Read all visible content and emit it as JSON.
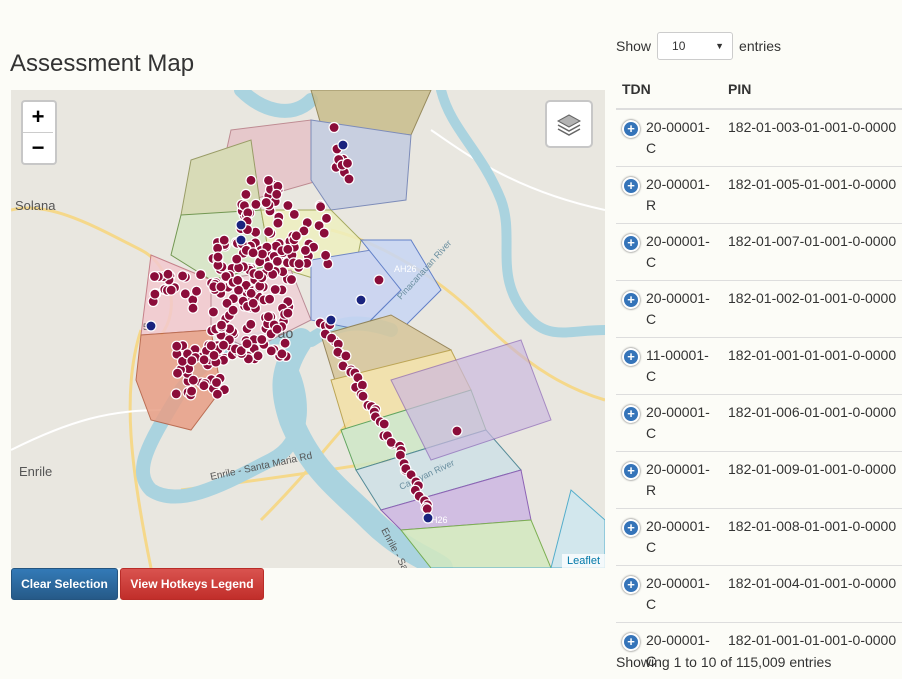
{
  "page": {
    "title": "Assessment Map"
  },
  "map": {
    "zoom_in": "+",
    "zoom_out": "−",
    "layers_icon": "layers-icon",
    "attribution": "Leaflet",
    "place_labels": {
      "solana": "Solana",
      "enrile": "Enrile",
      "rao": "rao",
      "road_ah26_a": "AH26",
      "road_ah26_b": "AH26",
      "road_enrile_santa_maria": "Enrile - Santa Maria Rd",
      "road_enrile_san": "Enrile - San",
      "river_pinacanauan": "Pinacanauan River",
      "river_cagayan": "Cagayan River",
      "road_51": "51"
    },
    "colors": {
      "marker_fill": "#8b0d3a",
      "marker_blue": "#1a237e",
      "river": "#aad3df"
    }
  },
  "buttons": {
    "clear_selection": "Clear Selection",
    "hotkeys_legend": "View Hotkeys Legend"
  },
  "table_controls": {
    "show_label": "Show",
    "length_value": "10",
    "entries_label": "entries"
  },
  "table": {
    "columns": [
      "TDN",
      "PIN"
    ],
    "rows": [
      {
        "tdn": "20-00001-C",
        "pin": "182-01-003-01-001-0-0000"
      },
      {
        "tdn": "20-00001-R",
        "pin": "182-01-005-01-001-0-0000"
      },
      {
        "tdn": "20-00001-C",
        "pin": "182-01-007-01-001-0-0000"
      },
      {
        "tdn": "20-00001-C",
        "pin": "182-01-002-01-001-0-0000"
      },
      {
        "tdn": "11-00001-C",
        "pin": "182-01-001-01-001-0-0000"
      },
      {
        "tdn": "20-00001-C",
        "pin": "182-01-006-01-001-0-0000"
      },
      {
        "tdn": "20-00001-R",
        "pin": "182-01-009-01-001-0-0000"
      },
      {
        "tdn": "20-00001-C",
        "pin": "182-01-008-01-001-0-0000"
      },
      {
        "tdn": "20-00001-C",
        "pin": "182-01-004-01-001-0-0000"
      },
      {
        "tdn": "20-00001-C",
        "pin": "182-01-001-01-001-0-0000"
      }
    ],
    "info": "Showing 1 to 10 of 115,009 entries"
  }
}
